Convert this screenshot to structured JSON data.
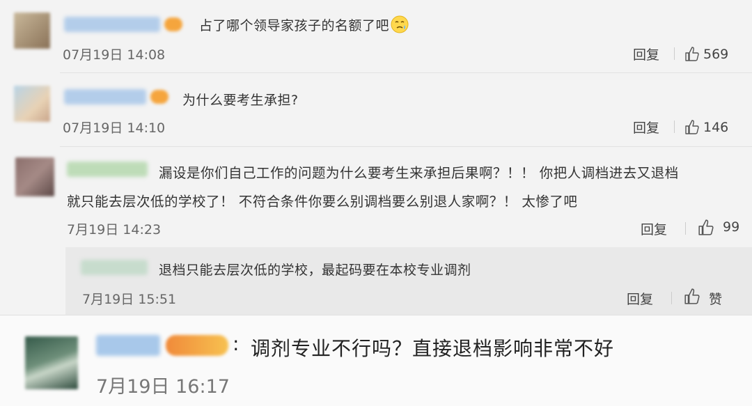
{
  "comments": [
    {
      "text": "占了哪个领导家孩子的名额了吧",
      "emoji": "sweat-smile-emoji",
      "time": "07月19日 14:08",
      "reply_label": "回复",
      "likes": "569"
    },
    {
      "text": "为什么要考生承担?",
      "time": "07月19日 14:10",
      "reply_label": "回复",
      "likes": "146"
    },
    {
      "text_line1": "漏设是你们自己工作的问题为什么要考生来承担后果啊？！！ 你把人调档进去又退档",
      "text_line2": "就只能去层次低的学校了！ 不符合条件你要么别调档要么别退人家啊？！ 太惨了吧",
      "time": "7月19日 14:23",
      "reply_label": "回复",
      "likes": "99"
    }
  ],
  "nested_reply": {
    "text": "退档只能去层次低的学校，最起码要在本校专业调剂",
    "time": "7月19日 15:51",
    "reply_label": "回复",
    "like_label": "赞"
  },
  "bottom_comment": {
    "separator": ":",
    "text": "调剂专业不行吗？直接退档影响非常不好",
    "time": "7月19日 16:17"
  },
  "colors": {
    "background": "#f3f3f3",
    "nested_background": "#e9e9e9",
    "bottom_background": "#fafafa",
    "username_blur": "#9fc3ea",
    "vip_badge": "#f5a53d"
  }
}
